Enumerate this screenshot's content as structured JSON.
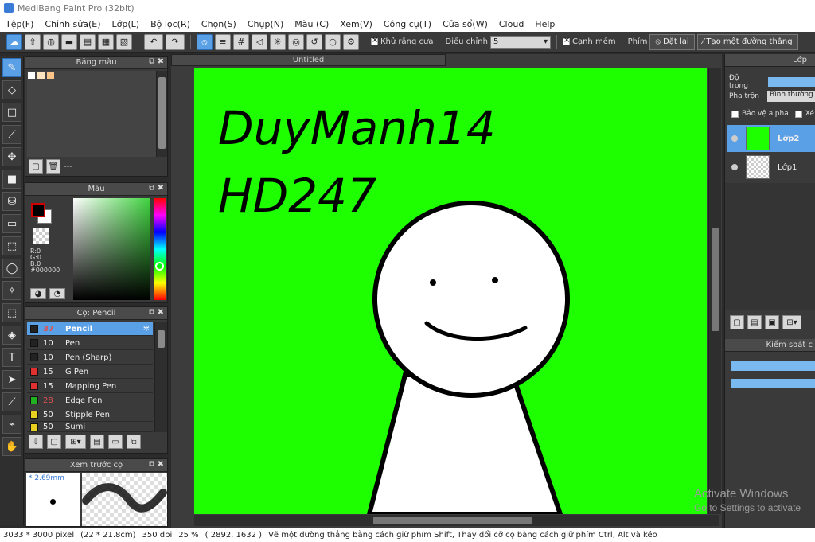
{
  "window": {
    "title": "MediBang Paint Pro (32bit)"
  },
  "menu": [
    "Tệp(F)",
    "Chỉnh sửa(E)",
    "Lớp(L)",
    "Bộ lọc(R)",
    "Chọn(S)",
    "Chụp(N)",
    "Màu (C)",
    "Xem(V)",
    "Công cụ(T)",
    "Cửa sổ(W)",
    "Cloud",
    "Help"
  ],
  "toolbar": {
    "antialias_label": "Khử răng cưa",
    "adjust_label": "Điều chỉnh",
    "adjust_value": "5",
    "soft_edge_label": "Cạnh mềm",
    "key_label": "Phím",
    "reset_label": "Đặt lại",
    "line_label": "Tạo một đường thẳng"
  },
  "palette_panel": {
    "title": "Bảng màu",
    "footer": "---",
    "swatches": [
      "#ffffff",
      "#fde3c0",
      "#fbc58a"
    ]
  },
  "color_panel": {
    "title": "Màu",
    "r": "R:0",
    "g": "G:0",
    "b": "B:0",
    "hex": "#000000"
  },
  "brush_panel": {
    "title": "Cọ: Pencil",
    "brushes": [
      {
        "size": "37",
        "name": "Pencil",
        "color": "#222222",
        "selected": true
      },
      {
        "size": "10",
        "name": "Pen",
        "color": "#222222"
      },
      {
        "size": "10",
        "name": "Pen (Sharp)",
        "color": "#222222"
      },
      {
        "size": "15",
        "name": "G Pen",
        "color": "#e03030"
      },
      {
        "size": "15",
        "name": "Mapping Pen",
        "color": "#e03030"
      },
      {
        "size": "28",
        "name": "Edge Pen",
        "color": "#20b020"
      },
      {
        "size": "50",
        "name": "Stipple Pen",
        "color": "#e8d020"
      },
      {
        "size": "50",
        "name": "Sumi",
        "color": "#e8d020"
      }
    ]
  },
  "preview_panel": {
    "title": "Xem trước cọ",
    "size": "* 2.69mm"
  },
  "document": {
    "tab": "Untitled",
    "text_line1": "DuyManh14",
    "text_line2": "HD247"
  },
  "layer_panel": {
    "title": "Lớp",
    "opacity_label": "Độ trong",
    "blend_label": "Pha trộn",
    "blend_value": "Bình thường",
    "protect_alpha": "Bảo vệ alpha",
    "clip_label": "Xé",
    "layers": [
      {
        "name": "Lớp2",
        "selected": true
      },
      {
        "name": "Lớp1"
      }
    ]
  },
  "control_panel": {
    "title": "Kiểm soát c"
  },
  "status": {
    "size": "3033 * 3000 pixel",
    "cm": "(22 * 21.8cm)",
    "dpi": "350 dpi",
    "zoom": "25 %",
    "coord": "( 2892, 1632 )",
    "hint": "Vẽ một đường thẳng bằng cách giữ phím Shift, Thay đổi cỡ cọ bằng cách giữ phím Ctrl, Alt và kéo"
  },
  "watermark": {
    "line1": "Activate Windows",
    "line2": "Go to Settings to activate"
  }
}
